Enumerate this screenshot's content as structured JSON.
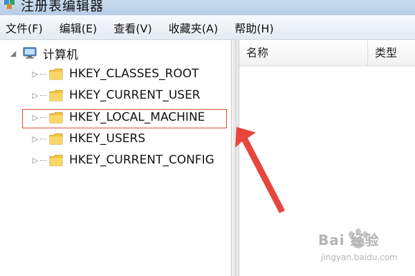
{
  "window": {
    "title": "注册表编辑器"
  },
  "menu": [
    {
      "label": "文件(F)"
    },
    {
      "label": "编辑(E)"
    },
    {
      "label": "查看(V)"
    },
    {
      "label": "收藏夹(A)"
    },
    {
      "label": "帮助(H)"
    }
  ],
  "tree": {
    "root": {
      "label": "计算机",
      "expander": "◢"
    },
    "items": [
      {
        "label": "HKEY_CLASSES_ROOT",
        "expander": "▷"
      },
      {
        "label": "HKEY_CURRENT_USER",
        "expander": "▷"
      },
      {
        "label": "HKEY_LOCAL_MACHINE",
        "expander": "▷"
      },
      {
        "label": "HKEY_USERS",
        "expander": "▷"
      },
      {
        "label": "HKEY_CURRENT_CONFIG",
        "expander": "▷"
      }
    ]
  },
  "list": {
    "columns": [
      {
        "label": "名称"
      },
      {
        "label": "类型"
      }
    ]
  },
  "annotation": {
    "highlight_color": "#e8453c",
    "arrow_color": "#e8453c"
  },
  "watermark": {
    "text": "Bai 经验",
    "sub": "jingyan.baidu.com"
  }
}
